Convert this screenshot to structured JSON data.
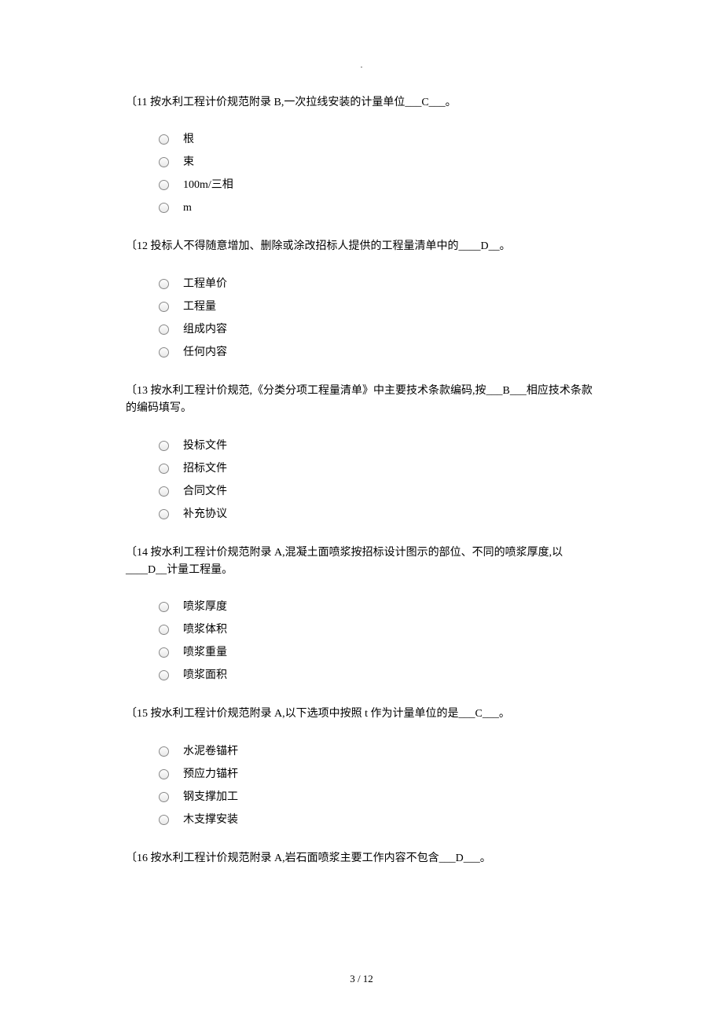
{
  "header_dot": ".",
  "questions": [
    {
      "text": "〔11 按水利工程计价规范附录 B,一次拉线安装的计量单位___C___。",
      "options": [
        "根",
        "束",
        "100m/三相",
        "m"
      ]
    },
    {
      "text": "〔12 投标人不得随意增加、删除或涂改招标人提供的工程量清单中的____D__。",
      "options": [
        "工程单价",
        "工程量",
        "组成内容",
        "任何内容"
      ]
    },
    {
      "text": "〔13 按水利工程计价规范,《分类分项工程量清单》中主要技术条款编码,按___B___相应技术条款的编码填写。",
      "options": [
        "投标文件",
        "招标文件",
        "合同文件",
        "补充协议"
      ]
    },
    {
      "text": "〔14 按水利工程计价规范附录 A,混凝土面喷浆按招标设计图示的部位、不同的喷浆厚度,以____D__计量工程量。",
      "options": [
        "喷浆厚度",
        "喷浆体积",
        "喷浆重量",
        "喷浆面积"
      ]
    },
    {
      "text": "〔15 按水利工程计价规范附录 A,以下选项中按照 t 作为计量单位的是___C___。",
      "options": [
        "水泥卷锚杆",
        "预应力锚杆",
        "钢支撑加工",
        "木支撑安装"
      ]
    },
    {
      "text": "〔16 按水利工程计价规范附录 A,岩石面喷浆主要工作内容不包含___D___。",
      "options": []
    }
  ],
  "footer": "3  /  12"
}
